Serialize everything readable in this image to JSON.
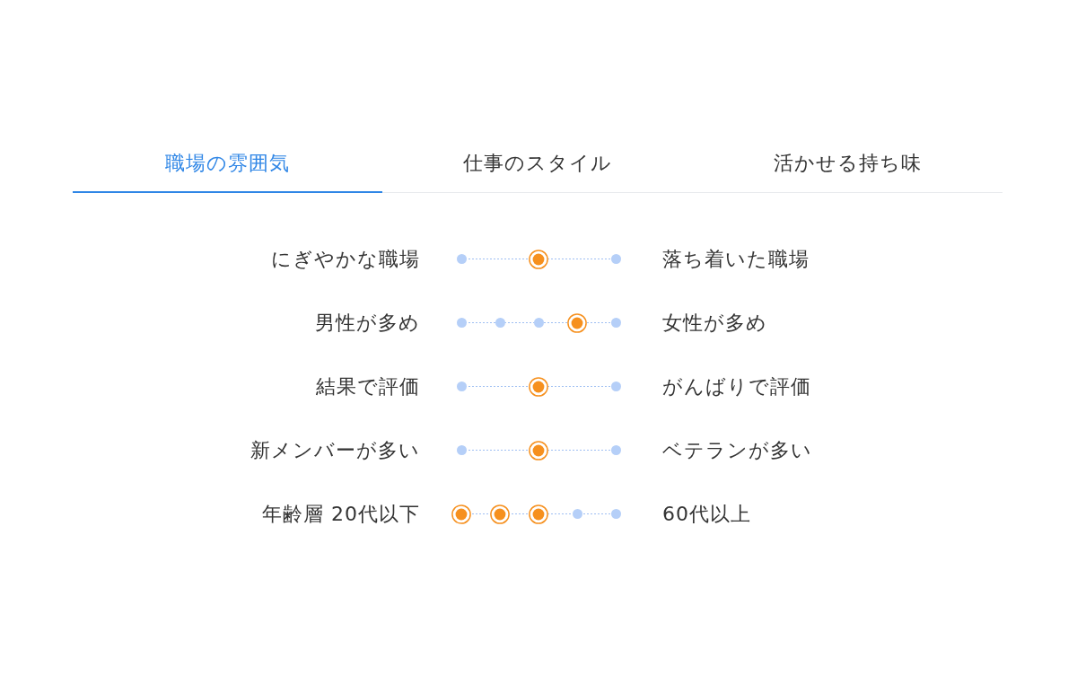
{
  "tabs": [
    {
      "label": "職場の雰囲気",
      "selected": true
    },
    {
      "label": "仕事のスタイル",
      "selected": false
    },
    {
      "label": "活かせる持ち味",
      "selected": false
    }
  ],
  "scales": [
    {
      "left_label": "にぎやかな職場",
      "right_label": "落ち着いた職場",
      "points": [
        {
          "selected": false
        },
        {
          "selected": true
        },
        {
          "selected": false
        }
      ]
    },
    {
      "left_label": "男性が多め",
      "right_label": "女性が多め",
      "points": [
        {
          "selected": false
        },
        {
          "selected": false
        },
        {
          "selected": false
        },
        {
          "selected": true
        },
        {
          "selected": false
        }
      ]
    },
    {
      "left_label": "結果で評価",
      "right_label": "がんばりで評価",
      "points": [
        {
          "selected": false
        },
        {
          "selected": true
        },
        {
          "selected": false
        }
      ]
    },
    {
      "left_label": "新メンバーが多い",
      "right_label": "ベテランが多い",
      "points": [
        {
          "selected": false
        },
        {
          "selected": true
        },
        {
          "selected": false
        }
      ]
    },
    {
      "left_label": "年齢層 20代以下",
      "right_label": "60代以上",
      "points": [
        {
          "selected": true
        },
        {
          "selected": true
        },
        {
          "selected": true
        },
        {
          "selected": false
        },
        {
          "selected": false
        }
      ]
    }
  ]
}
